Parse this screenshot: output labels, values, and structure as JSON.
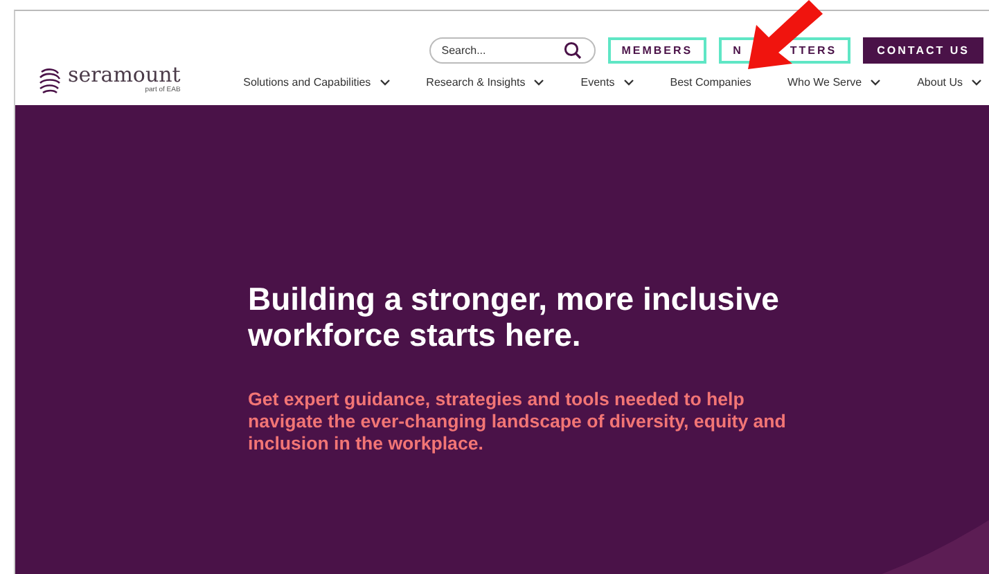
{
  "header": {
    "logo": {
      "name": "seramount",
      "tagline": "part of EAB"
    },
    "search": {
      "placeholder": "Search..."
    },
    "buttons": [
      {
        "kind": "outline",
        "parts": [
          "MEMBERS"
        ]
      },
      {
        "kind": "outline",
        "parts": [
          "N",
          "TTERS"
        ]
      },
      {
        "kind": "filled",
        "parts": [
          "CONTACT US"
        ]
      }
    ],
    "nav": [
      {
        "label": "Solutions and Capabilities",
        "dropdown": true
      },
      {
        "label": "Research & Insights",
        "dropdown": true
      },
      {
        "label": "Events",
        "dropdown": true
      },
      {
        "label": "Best Companies",
        "dropdown": false
      },
      {
        "label": "Who We Serve",
        "dropdown": true
      },
      {
        "label": "About Us",
        "dropdown": true
      }
    ]
  },
  "hero": {
    "heading": "Building a stronger, more inclusive workforce starts here.",
    "subheading": "Get expert guidance, strategies and tools needed to help navigate the ever-changing landscape of diversity, equity and inclusion in the workplace."
  }
}
